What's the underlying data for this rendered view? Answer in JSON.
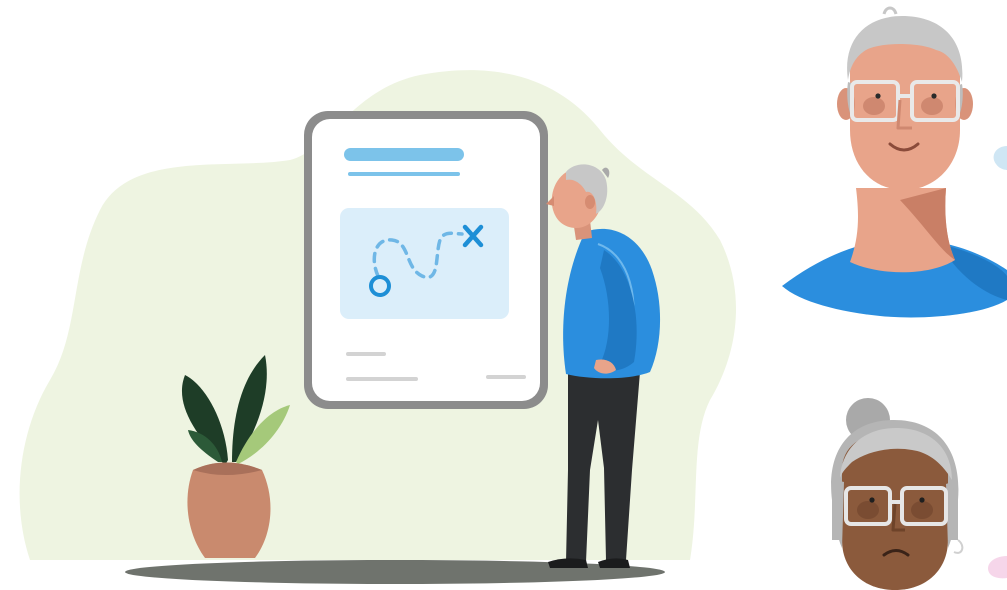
{
  "colors": {
    "background": "#ffffff",
    "blob": "#eef4e1",
    "shadow": "#6f736d",
    "card_frame": "#8c8c8c",
    "card_fill": "#ffffff",
    "accent_blue": "#7cc3ea",
    "map_fill": "#dbeefa",
    "route": "#1e8fd6",
    "sweater": "#2b8ede",
    "skin": "#e8a48a",
    "skin_dark": "#8b5a3c",
    "hair": "#c7c7c7",
    "pants": "#2c2e30",
    "pot": "#c98a6e",
    "leaf_dark": "#1e3d27",
    "leaf_light": "#a5c97a"
  },
  "icons": [
    "document-card-icon",
    "route-map-icon",
    "start-circle-icon",
    "destination-x-icon",
    "potted-plant-icon",
    "older-man-figure",
    "older-man-portrait",
    "older-woman-portrait"
  ]
}
